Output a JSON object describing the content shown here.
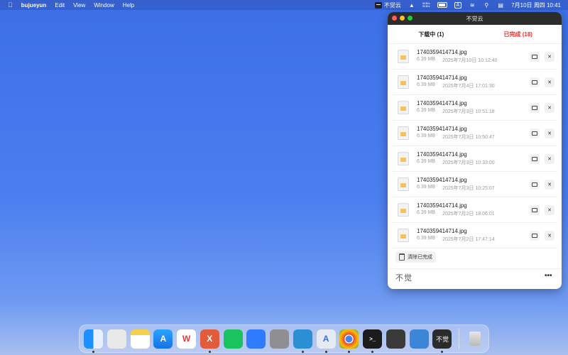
{
  "menubar": {
    "apple": "",
    "app_name": "bujueyun",
    "menus": [
      "Edit",
      "View",
      "Window",
      "Help"
    ],
    "status_app_name": "不觉云",
    "speed_up": "0KB/s",
    "speed_down": "0KB/s",
    "input_method": "A",
    "clock": "7月10日 周四  10:41"
  },
  "window": {
    "title": "不觉云",
    "tabs": [
      {
        "label": "下载中 (1)",
        "active": false
      },
      {
        "label": "已完成 (18)",
        "active": true
      }
    ],
    "files": [
      {
        "name": "1740359414714.jpg",
        "size": "6.39 MB",
        "date": "2025年7月10日 10:12:40"
      },
      {
        "name": "1740359414714.jpg",
        "size": "6.39 MB",
        "date": "2025年7月4日 17:01:30"
      },
      {
        "name": "1740359414714.jpg",
        "size": "6.39 MB",
        "date": "2025年7月3日 10:51:18"
      },
      {
        "name": "1740359414714.jpg",
        "size": "6.39 MB",
        "date": "2025年7月3日 10:50:47"
      },
      {
        "name": "1740359414714.jpg",
        "size": "6.39 MB",
        "date": "2025年7月3日 10:33:00"
      },
      {
        "name": "1740359414714.jpg",
        "size": "6.39 MB",
        "date": "2025年7月3日 10:25:07"
      },
      {
        "name": "1740359414714.jpg",
        "size": "6.39 MB",
        "date": "2025年7月2日 18:06:01"
      },
      {
        "name": "1740359414714.jpg",
        "size": "6.39 MB",
        "date": "2025年7月2日 17:47:14"
      }
    ],
    "clear_label": "清除已完成",
    "footer_logo": "不觉",
    "more_label": "•••"
  },
  "dock": {
    "apps": [
      {
        "icon": "finder-icon",
        "glyph": "",
        "running": true
      },
      {
        "icon": "launchpad-icon",
        "glyph": "",
        "running": false
      },
      {
        "icon": "notes-icon",
        "glyph": "",
        "running": false
      },
      {
        "icon": "app-store-icon",
        "glyph": "A",
        "running": false
      },
      {
        "icon": "wps-office-icon",
        "glyph": "W",
        "running": false
      },
      {
        "icon": "xmind-icon",
        "glyph": "X",
        "running": true
      },
      {
        "icon": "wechat-icon",
        "glyph": "",
        "running": false
      },
      {
        "icon": "lark-icon",
        "glyph": "",
        "running": false
      },
      {
        "icon": "system-settings-icon",
        "glyph": "",
        "running": false
      },
      {
        "icon": "vscode-icon",
        "glyph": "",
        "running": true
      },
      {
        "icon": "instruments-icon",
        "glyph": "A",
        "running": true
      },
      {
        "icon": "chrome-icon",
        "glyph": "",
        "running": true
      },
      {
        "icon": "terminal-icon",
        "glyph": ">_",
        "running": true
      },
      {
        "icon": "keychain-access-icon",
        "glyph": "",
        "running": false
      },
      {
        "icon": "xcode-icon",
        "glyph": "",
        "running": false
      },
      {
        "icon": "bujueyun-icon",
        "glyph": "不觉",
        "running": true
      }
    ],
    "trash": {
      "icon": "trash-icon"
    }
  }
}
